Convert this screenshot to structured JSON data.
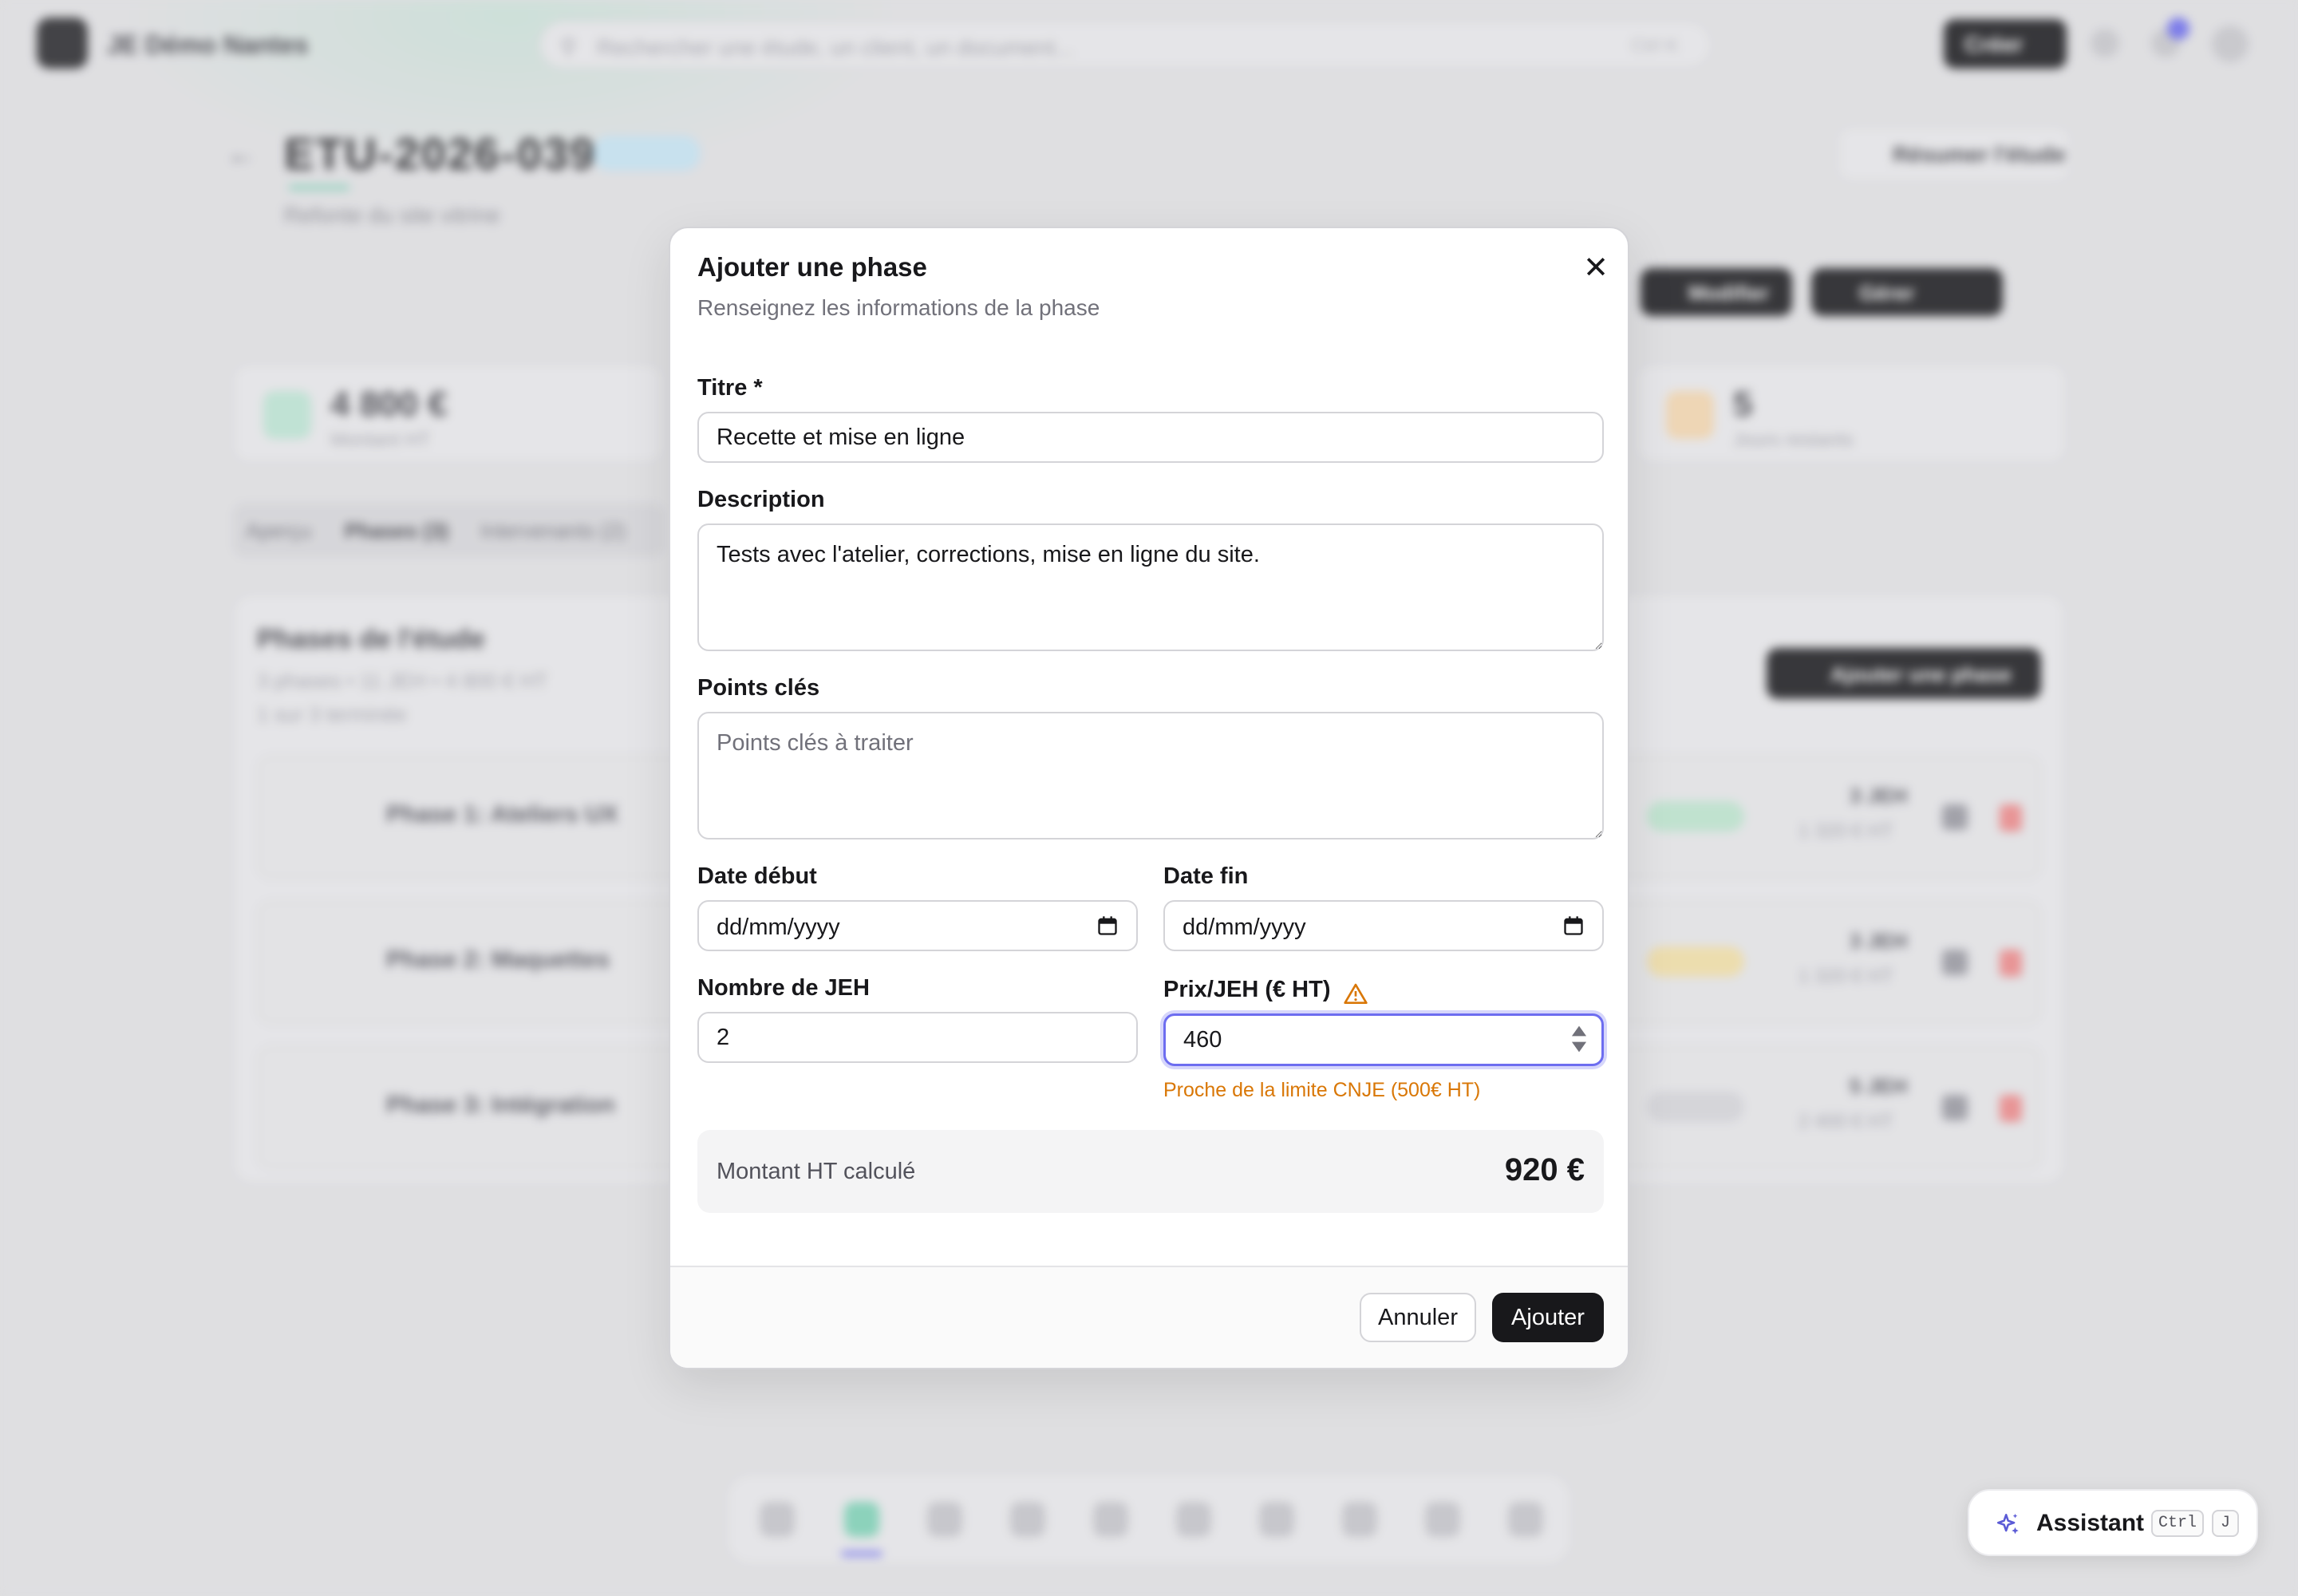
{
  "background": {
    "org_name": "JE Démo Nantes",
    "search_placeholder": "Rechercher une étude, un client, un document...",
    "search_shortcut": "Ctrl K",
    "create_label": "Créer",
    "page_title": "ETU-2026-039",
    "page_subtitle": "Refonte du site vitrine",
    "resume_label": "Résumer l'étude",
    "edit_label": "Modifier",
    "manage_label": "Gérer",
    "stats": [
      {
        "value": "4 800 €",
        "label": "Montant HT"
      },
      {
        "value": "5",
        "label": "Jours restants"
      }
    ],
    "tabs": [
      "Aperçu",
      "Phases (3)",
      "Intervenants (2)"
    ],
    "panel_title": "Phases de l'étude",
    "panel_sub_1": "3 phases • 11 JEH • 4 800 € HT",
    "panel_sub_2": "1 sur 3 terminée",
    "add_phase_label": "Ajouter une phase",
    "phases": [
      {
        "name": "Phase 1: Ateliers UX",
        "jeh": "3 JEH",
        "amount": "1 320 € HT"
      },
      {
        "name": "Phase 2: Maquettes",
        "jeh": "3 JEH",
        "amount": "1 320 € HT"
      },
      {
        "name": "Phase 3: Intégration",
        "jeh": "5 JEH",
        "amount": "2 400 € HT"
      }
    ]
  },
  "modal": {
    "title": "Ajouter une phase",
    "description": "Renseignez les informations de la phase",
    "fields": {
      "title_label": "Titre *",
      "title_value": "Recette et mise en ligne",
      "description_label": "Description",
      "description_value": "Tests avec l'atelier, corrections, mise en ligne du site.",
      "key_points_label": "Points clés",
      "key_points_placeholder": "Points clés à traiter",
      "start_label": "Date début",
      "start_value": "dd/mm/yyyy",
      "end_label": "Date fin",
      "end_value": "dd/mm/yyyy",
      "jeh_label": "Nombre de JEH",
      "jeh_value": "2",
      "price_label": "Prix/JEH (€ HT)",
      "price_value": "460",
      "price_warning": "Proche de la limite CNJE (500€ HT)"
    },
    "calc_label": "Montant HT calculé",
    "calc_value": "920 €",
    "cancel_label": "Annuler",
    "submit_label": "Ajouter"
  },
  "assistant": {
    "label": "Assistant",
    "key1": "Ctrl",
    "key2": "J"
  },
  "colors": {
    "accent": "#6d6df0",
    "warning": "#d97706",
    "primary_button": "#18181b",
    "brand_teal": "#7fd5b8"
  },
  "icons": [
    "search-icon",
    "close-icon",
    "calendar-icon",
    "warning-icon",
    "spinner-icon",
    "sparkle-icon",
    "bell-icon"
  ]
}
